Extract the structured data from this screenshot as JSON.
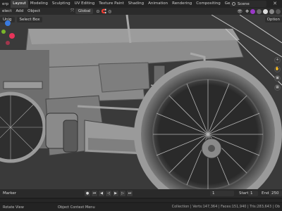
{
  "topbar": {
    "menus": [
      "erp"
    ],
    "tabs": [
      "Layout",
      "Modeling",
      "Sculpting",
      "UV Editing",
      "Texture Paint",
      "Shading",
      "Animation",
      "Rendering",
      "Compositing",
      "Geometry Nod"
    ],
    "active_tab": "Layout",
    "scene": "Scene"
  },
  "header": {
    "select": "elect",
    "add": "Add",
    "object": "Object",
    "transform": "Global"
  },
  "viewport": {
    "mode": "Unig",
    "select_box": "Select Box",
    "options": "Option"
  },
  "timeline": {
    "label": "Marker",
    "current_frame": "1",
    "start_label": "Start",
    "start": "1",
    "end_label": "End",
    "end": "250"
  },
  "status": {
    "left": "Rotate View",
    "middle": "Object Context Menu",
    "stats": "Collection | Verts:147,364 | Faces:151,940 | Tris:283,643 | Ob"
  },
  "colors": {
    "active_tab": "#3b3b3b",
    "gizmo_x": "#e8345a",
    "gizmo_y": "#7ab62b",
    "gizmo_z": "#3a7be0",
    "viewport_bg": "#3a3a3a"
  }
}
